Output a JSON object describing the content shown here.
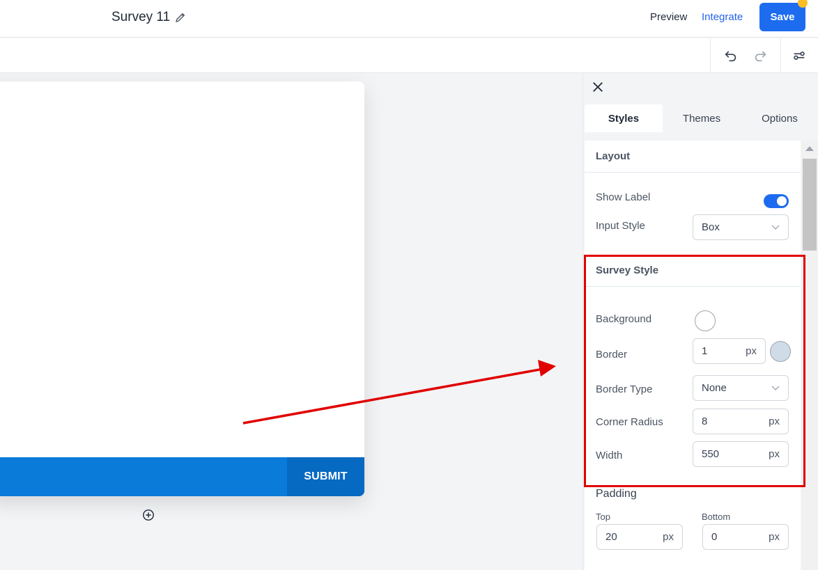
{
  "header": {
    "survey_title": "Survey 11",
    "preview_label": "Preview",
    "integrate_label": "Integrate",
    "save_label": "Save"
  },
  "canvas": {
    "submit_label": "SUBMIT"
  },
  "panel": {
    "tabs": [
      {
        "label": "Styles",
        "active": true
      },
      {
        "label": "Themes",
        "active": false
      },
      {
        "label": "Options",
        "active": false
      }
    ],
    "layout": {
      "heading": "Layout",
      "show_label": "Show Label",
      "show_label_on": true,
      "input_style_label": "Input Style",
      "input_style_value": "Box"
    },
    "survey_style": {
      "heading": "Survey Style",
      "background_label": "Background",
      "background_color": "#ffffff",
      "border_label": "Border",
      "border_value": "1",
      "border_unit": "px",
      "border_color": "#cfdce8",
      "border_type_label": "Border Type",
      "border_type_value": "None",
      "corner_radius_label": "Corner Radius",
      "corner_radius_value": "8",
      "corner_radius_unit": "px",
      "width_label": "Width",
      "width_value": "550",
      "width_unit": "px"
    },
    "padding": {
      "heading": "Padding",
      "top_label": "Top",
      "top_value": "20",
      "top_unit": "px",
      "bottom_label": "Bottom",
      "bottom_value": "0",
      "bottom_unit": "px"
    }
  },
  "colors": {
    "accent": "#1d6cf0",
    "submit_bar": "#0a7bd8",
    "highlight": "#e00000"
  }
}
